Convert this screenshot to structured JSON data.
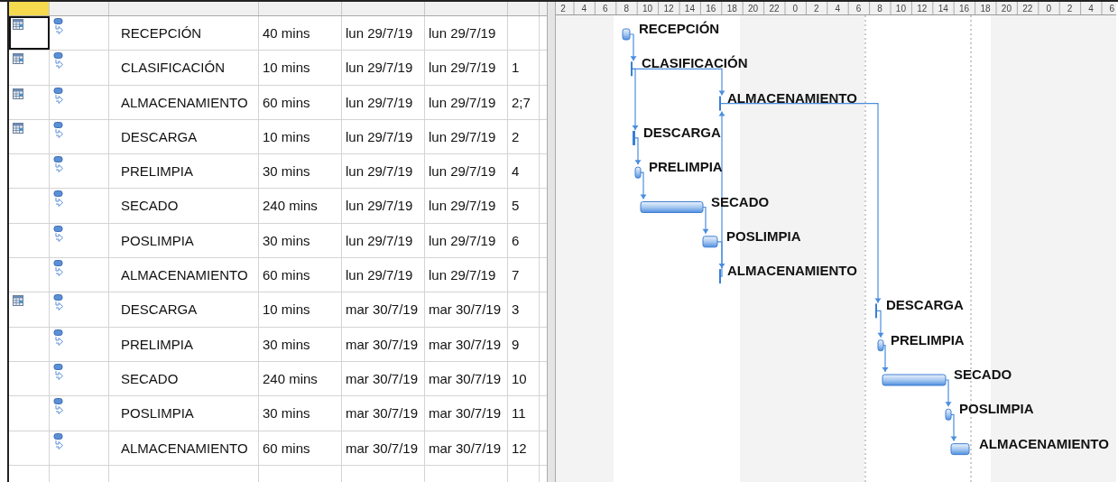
{
  "table": {
    "rows": [
      {
        "calendar_icon": true,
        "selected": true,
        "name": "RECEPCIÓN",
        "duration": "40 mins",
        "start": "lun 29/7/19",
        "finish": "lun 29/7/19"
      },
      {
        "calendar_icon": true,
        "selected": false,
        "name": "CLASIFICACIÓN",
        "duration": "10 mins",
        "start": "lun 29/7/19",
        "finish": "lun 29/7/19",
        "predecessors": "1"
      },
      {
        "calendar_icon": true,
        "selected": false,
        "name": "ALMACENAMIENTO",
        "duration": "60 mins",
        "start": "lun 29/7/19",
        "finish": "lun 29/7/19",
        "predecessors": "2;7"
      },
      {
        "calendar_icon": true,
        "selected": false,
        "name": "DESCARGA",
        "duration": "10 mins",
        "start": "lun 29/7/19",
        "finish": "lun 29/7/19",
        "predecessors": "2"
      },
      {
        "calendar_icon": false,
        "selected": false,
        "name": "PRELIMPIA",
        "duration": "30 mins",
        "start": "lun 29/7/19",
        "finish": "lun 29/7/19",
        "predecessors": "4"
      },
      {
        "calendar_icon": false,
        "selected": false,
        "name": "SECADO",
        "duration": "240 mins",
        "start": "lun 29/7/19",
        "finish": "lun 29/7/19",
        "predecessors": "5"
      },
      {
        "calendar_icon": false,
        "selected": false,
        "name": "POSLIMPIA",
        "duration": "30 mins",
        "start": "lun 29/7/19",
        "finish": "lun 29/7/19",
        "predecessors": "6"
      },
      {
        "calendar_icon": false,
        "selected": false,
        "name": "ALMACENAMIENTO",
        "duration": "60 mins",
        "start": "lun 29/7/19",
        "finish": "lun 29/7/19",
        "predecessors": "7"
      },
      {
        "calendar_icon": true,
        "selected": false,
        "name": "DESCARGA",
        "duration": "10 mins",
        "start": "mar 30/7/19",
        "finish": "mar 30/7/19",
        "predecessors": "3"
      },
      {
        "calendar_icon": false,
        "selected": false,
        "name": "PRELIMPIA",
        "duration": "30 mins",
        "start": "mar 30/7/19",
        "finish": "mar 30/7/19",
        "predecessors": "9"
      },
      {
        "calendar_icon": false,
        "selected": false,
        "name": "SECADO",
        "duration": "240 mins",
        "start": "mar 30/7/19",
        "finish": "mar 30/7/19",
        "predecessors": "10"
      },
      {
        "calendar_icon": false,
        "selected": false,
        "name": "POSLIMPIA",
        "duration": "30 mins",
        "start": "mar 30/7/19",
        "finish": "mar 30/7/19",
        "predecessors": "11"
      },
      {
        "calendar_icon": false,
        "selected": false,
        "name": "ALMACENAMIENTO",
        "duration": "60 mins",
        "start": "mar 30/7/19",
        "finish": "mar 30/7/19",
        "predecessors": "12"
      }
    ]
  },
  "gantt": {
    "timescale": [
      "2",
      "4",
      "6",
      "8",
      "10",
      "12",
      "14",
      "16",
      "18",
      "20",
      "22",
      "0",
      "2",
      "4",
      "6",
      "8",
      "10",
      "12",
      "14",
      "16",
      "18",
      "20",
      "22",
      "0",
      "2",
      "4",
      "6"
    ],
    "bars": [
      {
        "label": "RECEPCIÓN"
      },
      {
        "label": "CLASIFICACIÓN"
      },
      {
        "label": "ALMACENAMIENTO"
      },
      {
        "label": "DESCARGA"
      },
      {
        "label": "PRELIMPIA"
      },
      {
        "label": "SECADO"
      },
      {
        "label": "POSLIMPIA"
      },
      {
        "label": "ALMACENAMIENTO"
      },
      {
        "label": "DESCARGA"
      },
      {
        "label": "PRELIMPIA"
      },
      {
        "label": "SECADO"
      },
      {
        "label": "POSLIMPIA"
      },
      {
        "label": "ALMACENAMIENTO"
      }
    ]
  }
}
